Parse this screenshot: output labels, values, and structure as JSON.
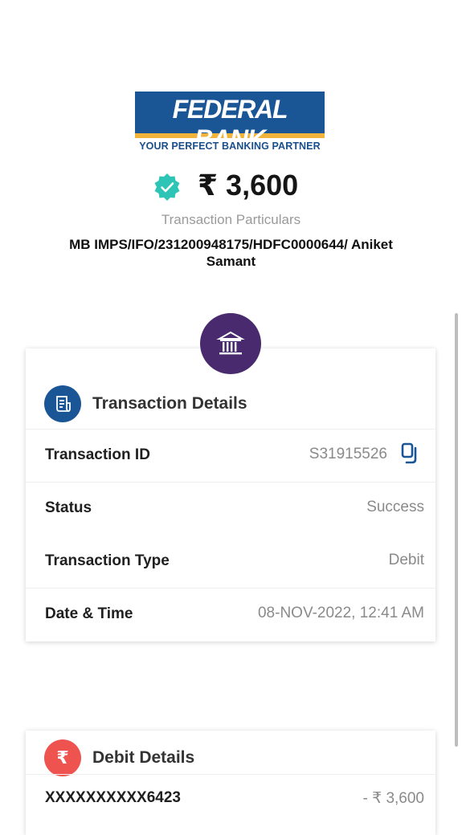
{
  "logo": {
    "name": "FEDERAL BANK",
    "tagline": "YOUR PERFECT BANKING PARTNER"
  },
  "summary": {
    "amount": "₹ 3,600",
    "particulars_label": "Transaction Particulars",
    "particulars": "MB IMPS/IFO/231200948175/HDFC0000644/ Aniket Samant"
  },
  "transaction_details": {
    "title": "Transaction Details",
    "rows": [
      {
        "label": "Transaction ID",
        "value": "S31915526"
      },
      {
        "label": "Status",
        "value": "Success"
      },
      {
        "label": "Transaction Type",
        "value": "Debit"
      },
      {
        "label": "Date & Time",
        "value": "08-NOV-2022, 12:41 AM"
      }
    ]
  },
  "debit_details": {
    "title": "Debit Details",
    "icon_symbol": "₹",
    "account": "XXXXXXXXXX6423",
    "amount": "-  ₹ 3,600"
  },
  "colors": {
    "brand_blue": "#1a5596",
    "brand_yellow": "#f2b33a",
    "bank_circle": "#4a2a6e",
    "verified": "#2ec4b6",
    "debit_icon": "#ef5350"
  },
  "icons": {
    "verified": "verified-badge-icon",
    "bank": "bank-building-icon",
    "receipt": "receipt-icon",
    "copy": "copy-icon",
    "rupee": "rupee-icon"
  }
}
